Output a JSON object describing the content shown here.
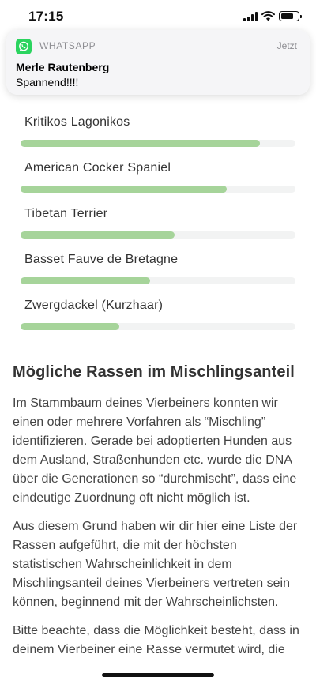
{
  "status_bar": {
    "time": "17:15",
    "battery_level": 0.8
  },
  "notification": {
    "app_name": "WHATSAPP",
    "time": "Jetzt",
    "sender": "Merle Rautenberg",
    "message": "Spannend!!!!"
  },
  "breeds": [
    {
      "name": "Kritikos Lagonikos",
      "share": 0.87
    },
    {
      "name": "American Cocker Spaniel",
      "share": 0.75
    },
    {
      "name": "Tibetan Terrier",
      "share": 0.56
    },
    {
      "name": "Basset Fauve de Bretagne",
      "share": 0.47
    },
    {
      "name": "Zwergdackel (Kurzhaar)",
      "share": 0.36
    }
  ],
  "section": {
    "title": "Mögliche Rassen im Mischlingsanteil",
    "paragraphs": [
      "Im Stammbaum deines Vierbeiners konnten wir einen oder mehrere Vorfahren als “Mischling” identifizieren. Gerade bei adoptierten Hunden aus dem Ausland, Straßenhunden etc. wurde die DNA über die Generationen so “durchmischt”, dass eine eindeutige Zuordnung oft nicht möglich ist.",
      "Aus diesem Grund haben wir dir hier eine Liste der Rassen aufgeführt, die mit der höchsten statistischen Wahrscheinlichkeit in dem Mischlingsanteil deines Vierbeiners vertreten sein können, beginnend mit der Wahrscheinlichsten.",
      "Bitte beachte, dass die Möglichkeit besteht, dass in deinem Vierbeiner eine Rasse vermutet wird, die"
    ]
  },
  "colors": {
    "bar_fill": "#a6d49a",
    "bar_track": "#f2f3f3",
    "whatsapp_green": "#2bd45f"
  }
}
